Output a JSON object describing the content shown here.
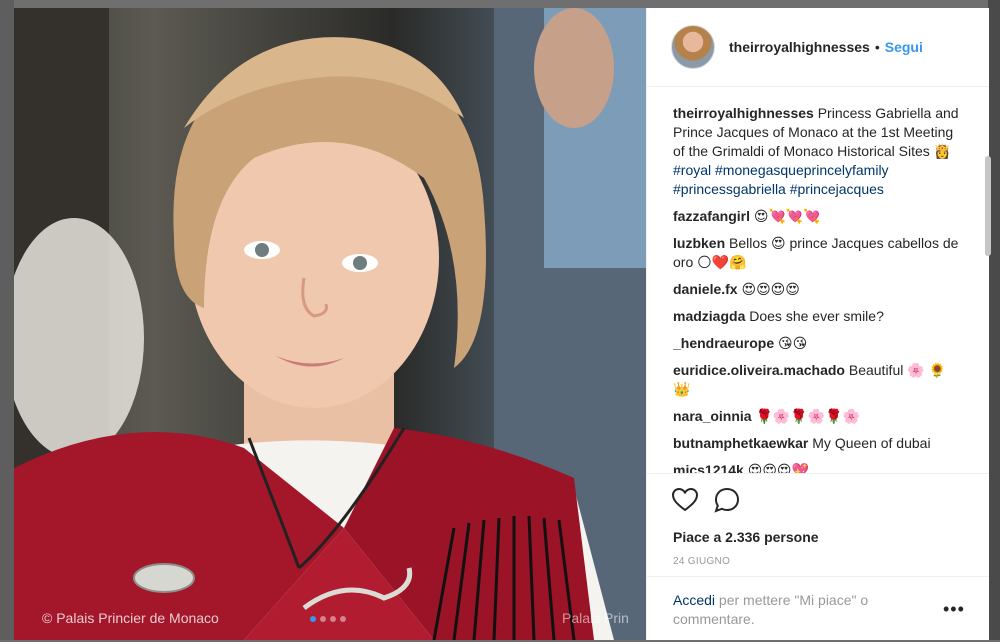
{
  "post": {
    "username": "theirroyalhighnesses",
    "separator": "•",
    "follow_label": "Segui",
    "caption": {
      "username": "theirroyalhighnesses",
      "text": "Princess Gabriella and Prince Jacques of Monaco at the 1st Meeting of the Grimaldi of Monaco Historical Sites 👸",
      "hashtags": "#royal #monegasqueprincelyfamily #princessgabriella #princejacques"
    },
    "comments": [
      {
        "user": "fazzafangirl",
        "text": "😍💘💘💘"
      },
      {
        "user": "luzbken",
        "text": "Bellos 😍 prince Jacques cabellos de oro 🌕❤️🤗"
      },
      {
        "user": "daniele.fx",
        "text": "😍😍😍😍"
      },
      {
        "user": "madziagda",
        "text": "Does she ever smile?"
      },
      {
        "user": "_hendraeurope",
        "text": "😘😘"
      },
      {
        "user": "euridice.oliveira.machado",
        "text": "Beautiful 🌸 🌻👑"
      },
      {
        "user": "nara_oinnia",
        "text": "🌹🌸🌹🌸🌹🌸"
      },
      {
        "user": "butnamphetkaewkar",
        "text": "My Queen of dubai"
      },
      {
        "user": "mics1214k",
        "text": "😍😍😍💖"
      }
    ],
    "likes_text": "Piace a 2.336 persone",
    "date": "24 GIUGNO",
    "login": {
      "link": "Accedi",
      "rest": " per mettere \"Mi piace\" o commentare."
    },
    "more_label": "•••"
  },
  "photo": {
    "watermark_left": "© Palais Princier de Monaco",
    "watermark_right": "Palais Prin",
    "carousel_pages": 4,
    "carousel_active": 1
  },
  "icons": {
    "like": "heart-outline-icon",
    "comment": "speech-bubble-icon",
    "more": "ellipsis-icon"
  },
  "colors": {
    "link_blue": "#3897f0",
    "hashtag": "#003569",
    "text": "#262626",
    "muted": "#999999"
  }
}
